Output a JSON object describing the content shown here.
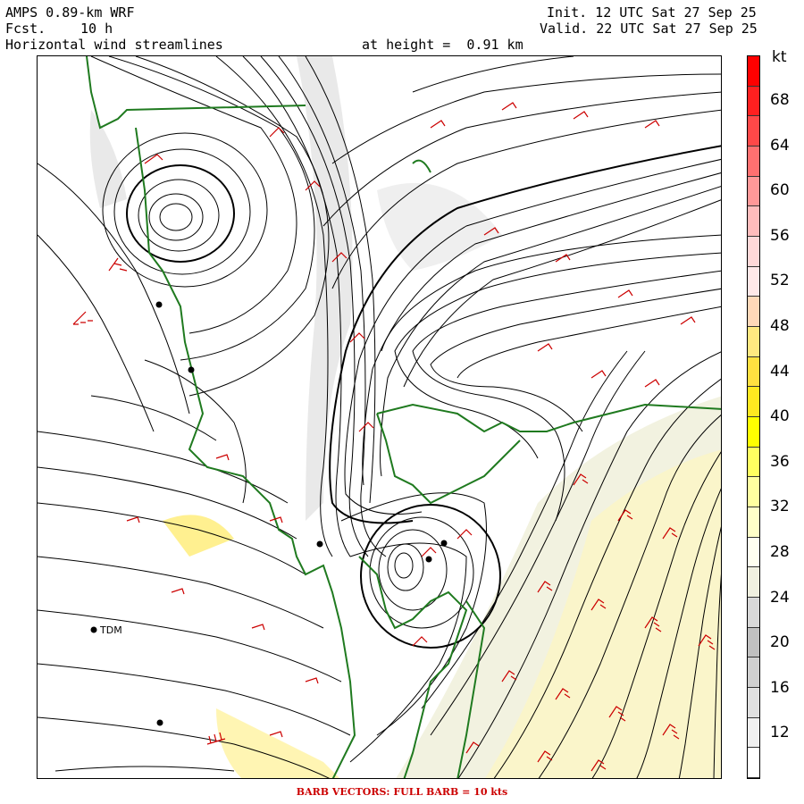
{
  "header": {
    "model": "AMPS 0.89-km WRF",
    "fcst_label": "Fcst.",
    "fcst_value": "10 h",
    "field": "Horizontal wind streamlines",
    "height": "at height =  0.91 km",
    "init": "Init. 12 UTC Sat 27 Sep 25",
    "valid": "Valid. 22 UTC Sat 27 Sep 25"
  },
  "colorbar": {
    "unit": "kt",
    "labels": [
      "68",
      "64",
      "60",
      "56",
      "52",
      "48",
      "44",
      "40",
      "36",
      "32",
      "28",
      "24",
      "20",
      "16",
      "12"
    ],
    "colors": [
      "#ff0000",
      "#ff2020",
      "#ff4848",
      "#ff7070",
      "#ff9898",
      "#ffbcbc",
      "#ffd8d8",
      "#ffe8e8",
      "#ffd8b8",
      "#ffe880",
      "#ffe040",
      "#ffe820",
      "#ffff00",
      "#ffff60",
      "#ffffa0",
      "#ffffc8",
      "#fffff0",
      "#f0f0e0",
      "#d8d8d8",
      "#c0c0c0",
      "#d0d0d0",
      "#e0e0e0",
      "#f0f0f0",
      "#ffffff"
    ]
  },
  "stations": [
    {
      "label": "TDM"
    }
  ],
  "footer": "BARB VECTORS:  FULL BARB = 10 kts"
}
